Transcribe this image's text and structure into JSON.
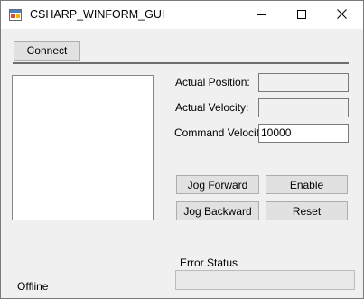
{
  "window": {
    "title": "CSHARP_WINFORM_GUI",
    "icon": "winform-app-icon",
    "controls": [
      "minimize-icon",
      "maximize-icon",
      "close-icon"
    ]
  },
  "toolbar": {
    "connect_label": "Connect"
  },
  "fields": {
    "actual_position_label": "Actual Position:",
    "actual_position_value": "",
    "actual_velocity_label": "Actual Velocity:",
    "actual_velocity_value": "",
    "command_velocity_label": "Command Velocity:",
    "command_velocity_value": "10000"
  },
  "buttons": {
    "jog_forward": "Jog Forward",
    "enable": "Enable",
    "jog_backward": "Jog Backward",
    "reset": "Reset"
  },
  "status": {
    "connection": "Offline",
    "error_label": "Error Status",
    "error_value": ""
  }
}
